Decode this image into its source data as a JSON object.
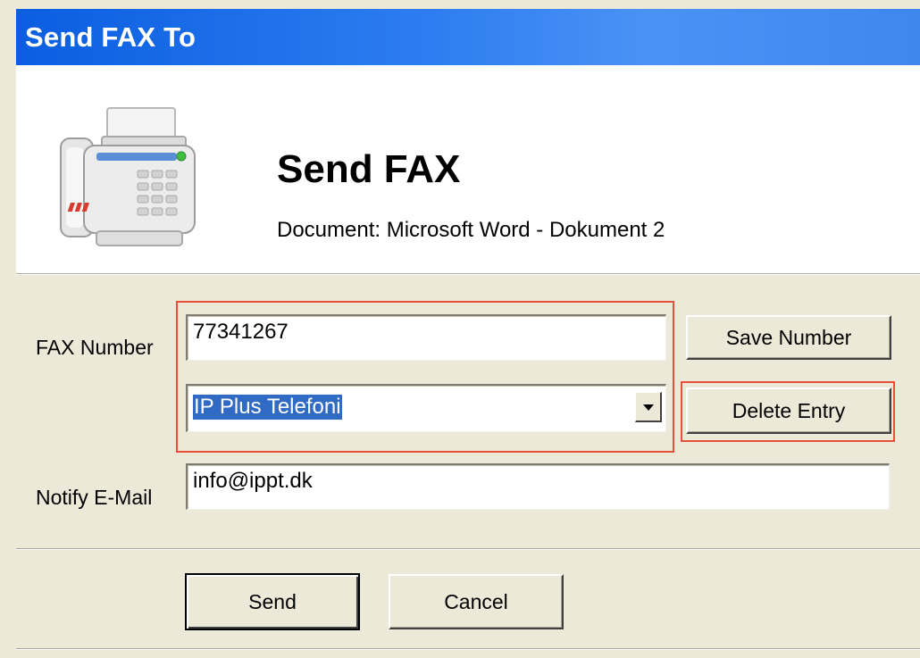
{
  "window": {
    "title": "Send FAX To"
  },
  "header": {
    "title": "Send FAX",
    "document_line": "Document: Microsoft Word - Dokument 2",
    "icon": "fax-machine-icon"
  },
  "form": {
    "fax_number_label": "FAX Number",
    "fax_number_value": "77341267",
    "phonebook_selected": "IP Plus Telefoni",
    "notify_email_label": "Notify E-Mail",
    "notify_email_value": "info@ippt.dk"
  },
  "buttons": {
    "save_number": "Save Number",
    "delete_entry": "Delete Entry",
    "send": "Send",
    "cancel": "Cancel"
  },
  "colors": {
    "titlebar": "#0a5ee0",
    "highlight": "#e8503a",
    "selection": "#316ac5"
  }
}
